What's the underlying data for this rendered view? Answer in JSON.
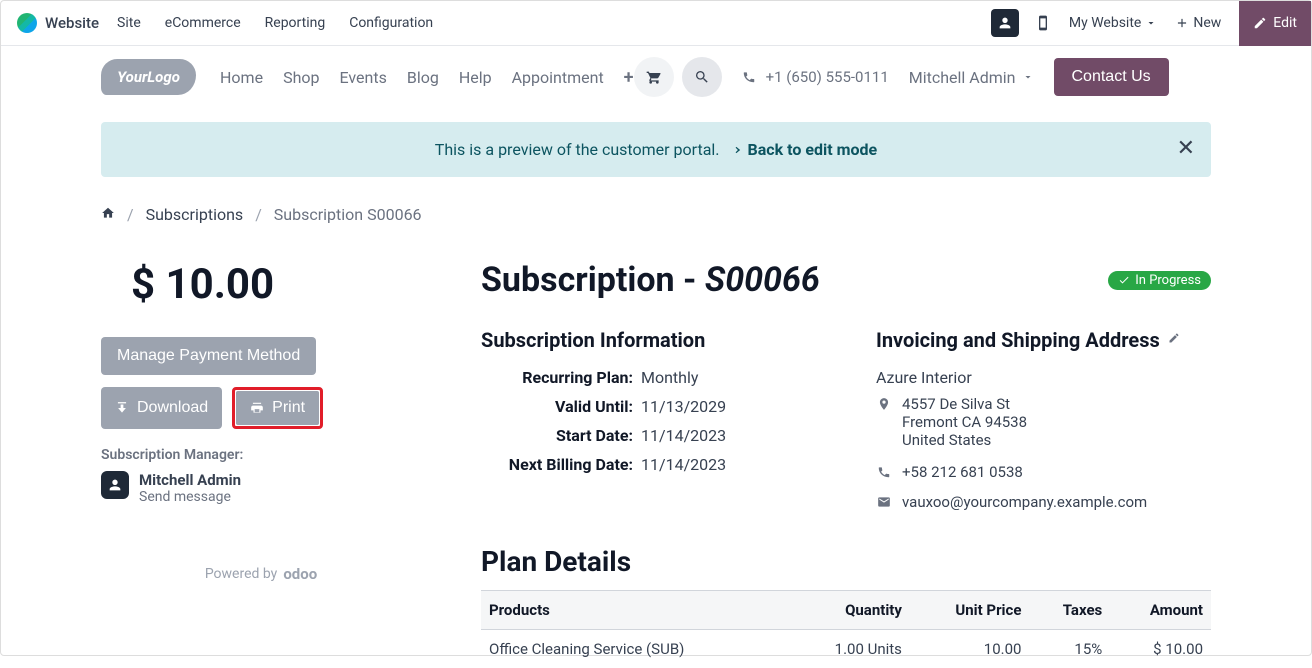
{
  "sysbar": {
    "brand": "Website",
    "menu": [
      "Site",
      "eCommerce",
      "Reporting",
      "Configuration"
    ],
    "my_website": "My Website",
    "new_label": "New",
    "edit_label": "Edit"
  },
  "nav": {
    "items": [
      "Home",
      "Shop",
      "Events",
      "Blog",
      "Help",
      "Appointment"
    ],
    "phone": "+1 (650) 555-0111",
    "user": "Mitchell Admin",
    "contact": "Contact Us"
  },
  "banner": {
    "text": "This is a preview of the customer portal.",
    "back": "Back to edit mode"
  },
  "breadcrumb": {
    "home": "home",
    "sub": "Subscriptions",
    "current": "Subscription S00066"
  },
  "left": {
    "price": "$ 10.00",
    "manage": "Manage Payment Method",
    "download": "Download",
    "print": "Print",
    "manager_label": "Subscription Manager:",
    "manager_name": "Mitchell Admin",
    "send": "Send message",
    "powered": "Powered by"
  },
  "right": {
    "title_prefix": "Subscription - ",
    "title_ref": "S00066",
    "badge": "In Progress",
    "info_h": "Subscription Information",
    "kv": [
      {
        "k": "Recurring Plan:",
        "v": "Monthly"
      },
      {
        "k": "Valid Until:",
        "v": "11/13/2029"
      },
      {
        "k": "Start Date:",
        "v": "11/14/2023"
      },
      {
        "k": "Next Billing Date:",
        "v": "11/14/2023"
      }
    ],
    "addr_h": "Invoicing and Shipping Address",
    "addr_name": "Azure Interior",
    "addr_lines": [
      "4557 De Silva St",
      "Fremont CA 94538",
      "United States"
    ],
    "addr_phone": "+58 212 681 0538",
    "addr_email": "vauxoo@yourcompany.example.com",
    "plan_h": "Plan Details",
    "table": {
      "headers": [
        "Products",
        "Quantity",
        "Unit Price",
        "Taxes",
        "Amount"
      ],
      "rows": [
        {
          "product": "Office Cleaning Service (SUB)",
          "qty": "1.00 Units",
          "unit": "10.00",
          "tax": "15%",
          "amount": "$ 10.00"
        }
      ]
    }
  }
}
